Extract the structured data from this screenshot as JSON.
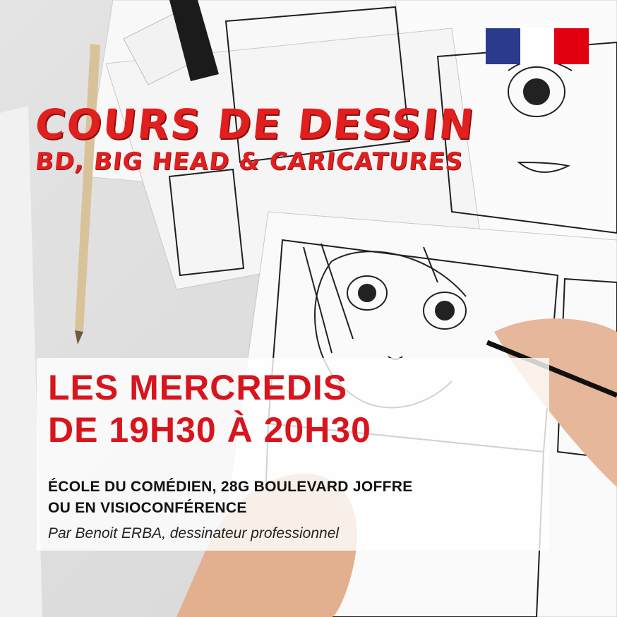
{
  "logo": {
    "name": "french-republic-flag-logo",
    "colors": {
      "blue": "#2b3a8c",
      "white": "#ffffff",
      "red": "#e1000f"
    }
  },
  "headline": {
    "title": "COURS DE DESSIN",
    "subtitle": "BD, BIG HEAD & CARICATURES",
    "color": "#e21f1f"
  },
  "schedule": {
    "line1": "LES MERCREDIS",
    "line2": "DE 19H30 À 20H30",
    "color": "#d8141c"
  },
  "details": {
    "address_line1": "ÉCOLE DU COMÉDIEN, 28G BOULEVARD JOFFRE",
    "address_line2": "OU EN VISIOCONFÉRENCE",
    "instructor": "Par Benoit ERBA, dessinateur professionnel"
  },
  "background": {
    "subject": "manga-sketches-photo",
    "colors": {
      "paper": "#f7f7f7",
      "table": "#e3e3e3",
      "ink": "#1e1e1e",
      "skin": "#e6b79a",
      "pencil": "#d9c29a"
    }
  }
}
